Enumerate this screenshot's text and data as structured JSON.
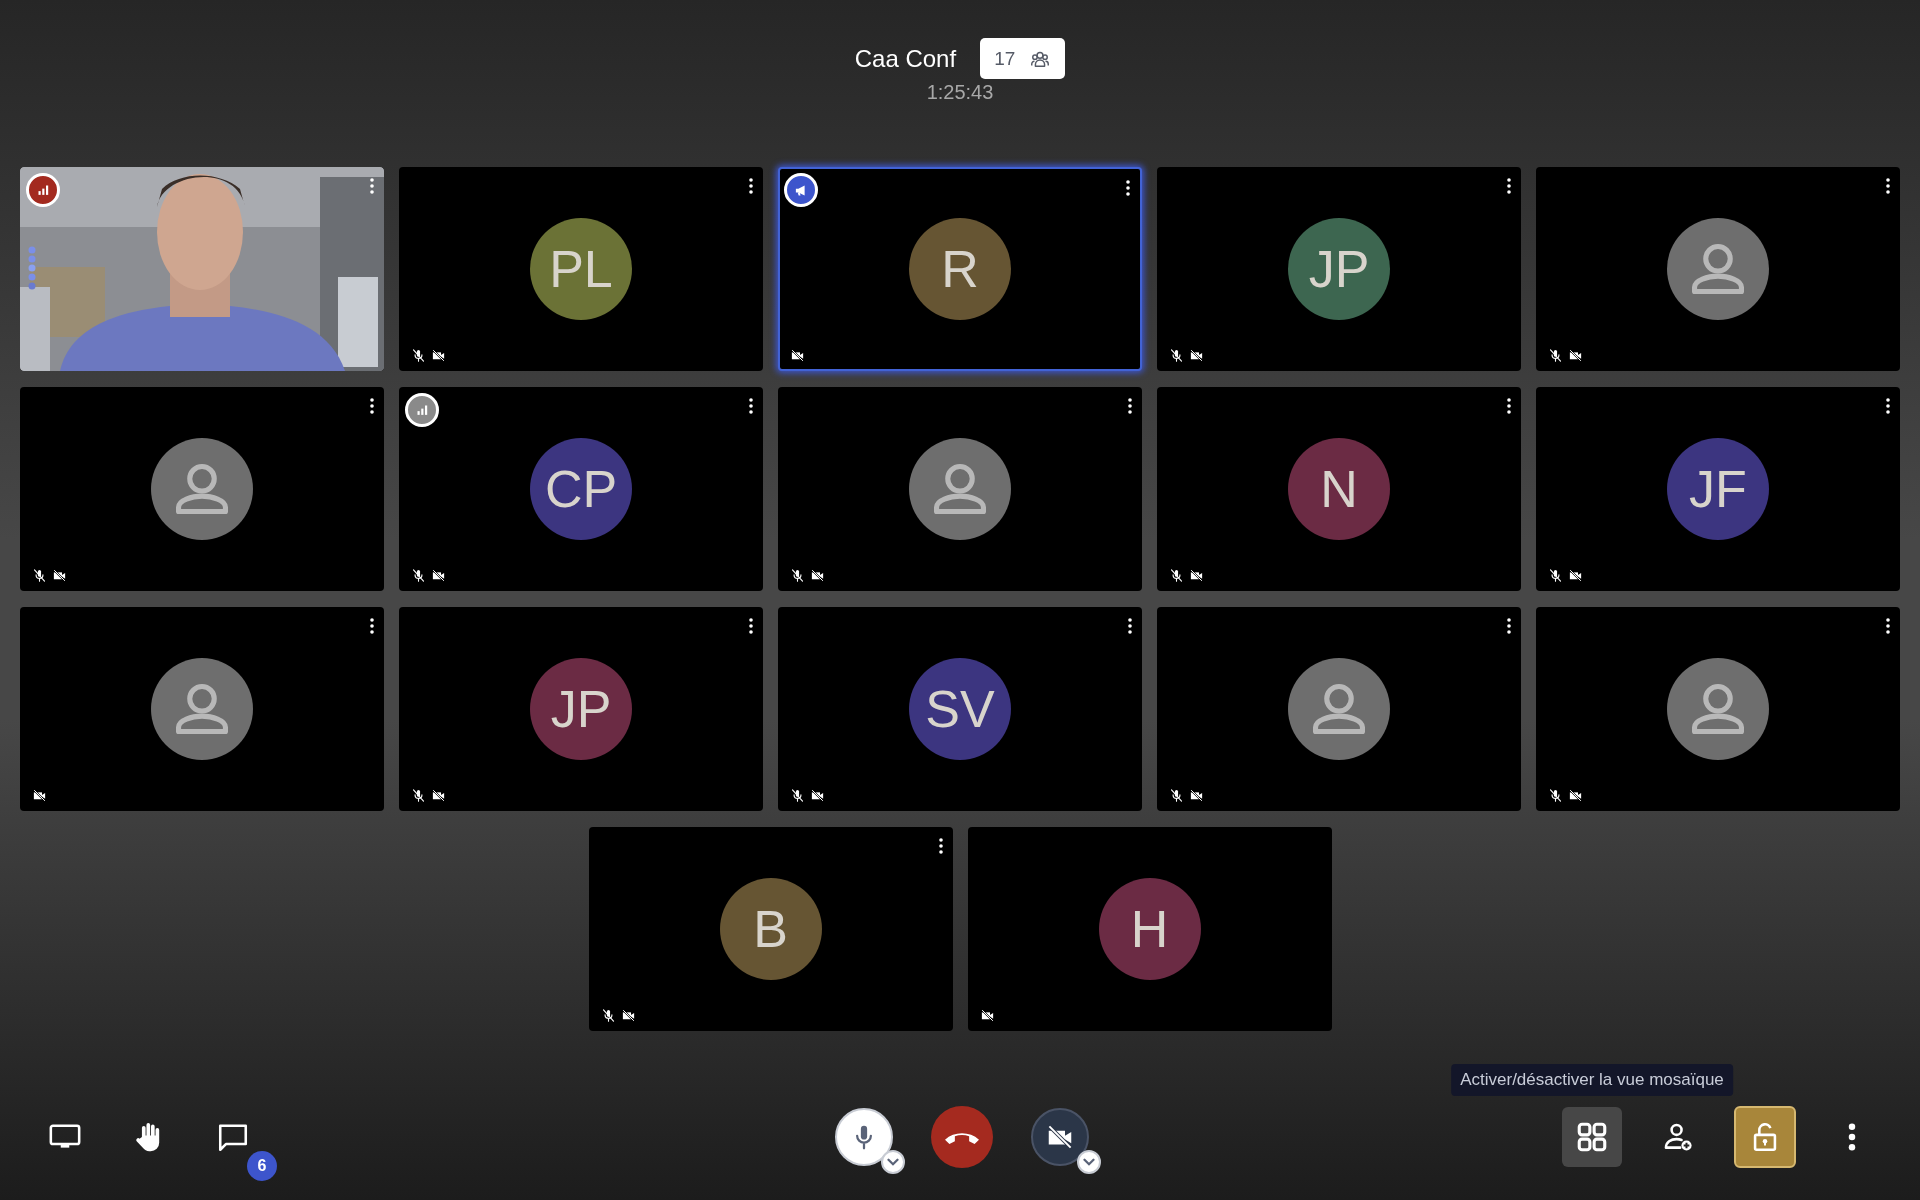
{
  "conference": {
    "title": "Caa Conf",
    "participant_count": "17",
    "timer": "1:25:43"
  },
  "tiles": [
    {
      "kind": "video",
      "indicator": {
        "kind": "quality",
        "color": "#a32a1f"
      },
      "speaking": true,
      "mic_muted": false,
      "camera_off": false,
      "dominant": false,
      "menu": true
    },
    {
      "kind": "initials",
      "initials": "PL",
      "color": "#6b7236",
      "mic_muted": true,
      "camera_off": true,
      "dominant": false,
      "menu": true
    },
    {
      "kind": "initials",
      "initials": "R",
      "color": "#665533",
      "indicator": {
        "kind": "moderator",
        "color": "#3d55cc"
      },
      "mic_muted": false,
      "camera_off": true,
      "dominant": true,
      "menu": true
    },
    {
      "kind": "initials",
      "initials": "JP",
      "color": "#3d6650",
      "mic_muted": true,
      "camera_off": true,
      "dominant": false,
      "menu": true
    },
    {
      "kind": "placeholder",
      "mic_muted": true,
      "camera_off": true,
      "dominant": false,
      "menu": true
    },
    {
      "kind": "placeholder",
      "mic_muted": true,
      "camera_off": true,
      "dominant": false,
      "menu": true
    },
    {
      "kind": "initials",
      "initials": "CP",
      "color": "#3c3580",
      "indicator": {
        "kind": "quality",
        "color": "#8a8a8a"
      },
      "mic_muted": true,
      "camera_off": true,
      "dominant": false,
      "menu": true
    },
    {
      "kind": "placeholder",
      "mic_muted": true,
      "camera_off": true,
      "dominant": false,
      "menu": true
    },
    {
      "kind": "initials",
      "initials": "N",
      "color": "#6b2b44",
      "mic_muted": true,
      "camera_off": true,
      "dominant": false,
      "menu": true
    },
    {
      "kind": "initials",
      "initials": "JF",
      "color": "#3c3580",
      "mic_muted": true,
      "camera_off": true,
      "dominant": false,
      "menu": true
    },
    {
      "kind": "placeholder",
      "mic_muted": false,
      "camera_off": true,
      "dominant": false,
      "menu": true
    },
    {
      "kind": "initials",
      "initials": "JP",
      "color": "#6b2b44",
      "mic_muted": true,
      "camera_off": true,
      "dominant": false,
      "menu": true
    },
    {
      "kind": "initials",
      "initials": "SV",
      "color": "#3c3580",
      "mic_muted": true,
      "camera_off": true,
      "dominant": false,
      "menu": true
    },
    {
      "kind": "placeholder",
      "mic_muted": true,
      "camera_off": true,
      "dominant": false,
      "menu": true
    },
    {
      "kind": "placeholder",
      "mic_muted": true,
      "camera_off": true,
      "dominant": false,
      "menu": true
    },
    {
      "kind": "initials",
      "initials": "B",
      "color": "#665533",
      "mic_muted": true,
      "camera_off": true,
      "dominant": false,
      "menu": true
    },
    {
      "kind": "initials",
      "initials": "H",
      "color": "#6b2b44",
      "mic_muted": false,
      "camera_off": true,
      "dominant": false,
      "menu": false
    }
  ],
  "toolbar": {
    "left": [
      {
        "kind": "screen-share"
      },
      {
        "kind": "raise-hand"
      },
      {
        "kind": "chat",
        "badge": "6"
      }
    ],
    "center": [
      {
        "kind": "microphone",
        "on": true
      },
      {
        "kind": "hangup"
      },
      {
        "kind": "camera",
        "on": false
      }
    ],
    "right": [
      {
        "kind": "tile-view",
        "selected": true,
        "tooltip": "Activer/désactiver la vue mosaïque"
      },
      {
        "kind": "invite"
      },
      {
        "kind": "security",
        "on": true
      },
      {
        "kind": "more"
      }
    ]
  }
}
